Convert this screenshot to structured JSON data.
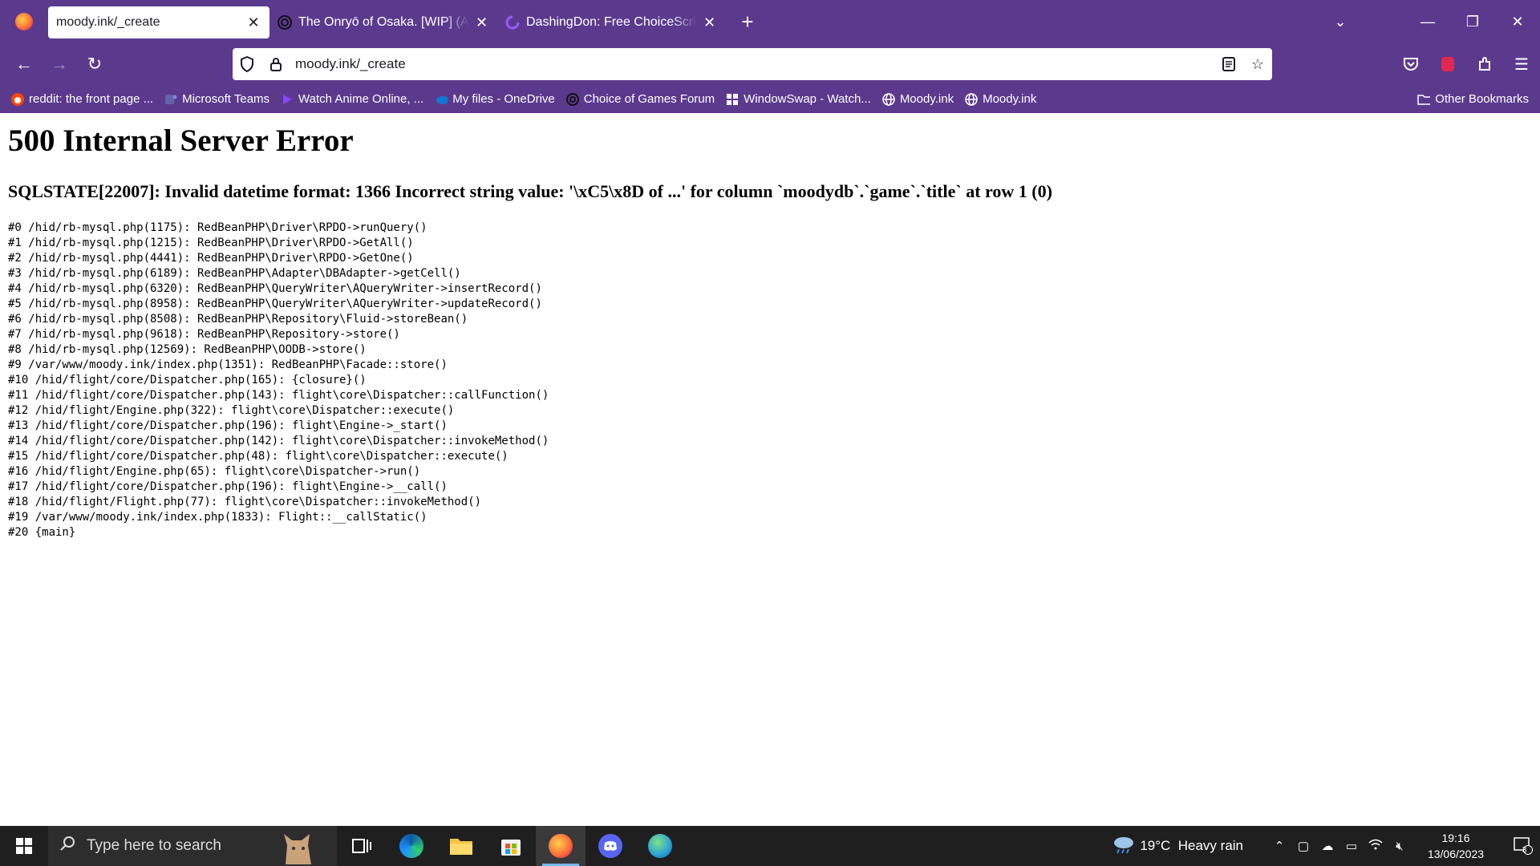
{
  "tabs": [
    {
      "title": "moody.ink/_create",
      "active": true,
      "favicon": "firefox-icon"
    },
    {
      "title": "The Onryō of Osaka. [WIP] (Act",
      "active": false,
      "favicon": "choice-of-games-icon"
    },
    {
      "title": "DashingDon: Free ChoiceScript",
      "active": false,
      "favicon": "dashingdon-icon"
    }
  ],
  "address": {
    "url": "moody.ink/_create"
  },
  "bookmarks": [
    {
      "label": "reddit: the front page ...",
      "icon": "reddit-icon"
    },
    {
      "label": "Microsoft Teams",
      "icon": "teams-icon"
    },
    {
      "label": "Watch Anime Online, ...",
      "icon": "play-icon"
    },
    {
      "label": "My files - OneDrive",
      "icon": "onedrive-icon"
    },
    {
      "label": "Choice of Games Forum",
      "icon": "choice-of-games-icon"
    },
    {
      "label": "WindowSwap - Watch...",
      "icon": "windowswap-icon"
    },
    {
      "label": "Moody.ink",
      "icon": "globe-icon"
    },
    {
      "label": "Moody.ink",
      "icon": "globe-icon"
    }
  ],
  "bookmarks_other": "Other Bookmarks",
  "error": {
    "title": "500 Internal Server Error",
    "message": "SQLSTATE[22007]: Invalid datetime format: 1366 Incorrect string value: '\\xC5\\x8D of ...' for column `moodydb`.`game`.`title` at row 1 (0)",
    "trace": [
      "#0 /hid/rb-mysql.php(1175): RedBeanPHP\\Driver\\RPDO->runQuery()",
      "#1 /hid/rb-mysql.php(1215): RedBeanPHP\\Driver\\RPDO->GetAll()",
      "#2 /hid/rb-mysql.php(4441): RedBeanPHP\\Driver\\RPDO->GetOne()",
      "#3 /hid/rb-mysql.php(6189): RedBeanPHP\\Adapter\\DBAdapter->getCell()",
      "#4 /hid/rb-mysql.php(6320): RedBeanPHP\\QueryWriter\\AQueryWriter->insertRecord()",
      "#5 /hid/rb-mysql.php(8958): RedBeanPHP\\QueryWriter\\AQueryWriter->updateRecord()",
      "#6 /hid/rb-mysql.php(8508): RedBeanPHP\\Repository\\Fluid->storeBean()",
      "#7 /hid/rb-mysql.php(9618): RedBeanPHP\\Repository->store()",
      "#8 /hid/rb-mysql.php(12569): RedBeanPHP\\OODB->store()",
      "#9 /var/www/moody.ink/index.php(1351): RedBeanPHP\\Facade::store()",
      "#10 /hid/flight/core/Dispatcher.php(165): {closure}()",
      "#11 /hid/flight/core/Dispatcher.php(143): flight\\core\\Dispatcher::callFunction()",
      "#12 /hid/flight/Engine.php(322): flight\\core\\Dispatcher::execute()",
      "#13 /hid/flight/core/Dispatcher.php(196): flight\\Engine->_start()",
      "#14 /hid/flight/core/Dispatcher.php(142): flight\\core\\Dispatcher::invokeMethod()",
      "#15 /hid/flight/core/Dispatcher.php(48): flight\\core\\Dispatcher::execute()",
      "#16 /hid/flight/Engine.php(65): flight\\core\\Dispatcher->run()",
      "#17 /hid/flight/core/Dispatcher.php(196): flight\\Engine->__call()",
      "#18 /hid/flight/Flight.php(77): flight\\core\\Dispatcher::invokeMethod()",
      "#19 /var/www/moody.ink/index.php(1833): Flight::__callStatic()",
      "#20 {main}"
    ]
  },
  "taskbar": {
    "search_placeholder": "Type here to search",
    "weather": "19°C  Heavy rain",
    "time": "19:16",
    "date": "13/06/2023",
    "notifications": "3"
  },
  "colors": {
    "chrome": "#5b3a8e",
    "taskbar": "#1f1f1f",
    "accent": "#76b9ed"
  }
}
